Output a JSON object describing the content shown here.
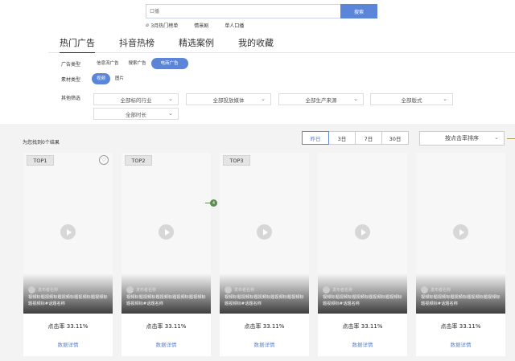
{
  "search": {
    "placeholder": "口播",
    "button": "搜索"
  },
  "hot_links": [
    "3月热门榜单",
    "情景剧",
    "单人口播"
  ],
  "tabs": [
    "热门广告",
    "抖音热榜",
    "精选案例",
    "我的收藏"
  ],
  "filters": {
    "ad_type": {
      "label": "广告类型",
      "options": [
        "信息流广告",
        "搜索广告",
        "电商广告"
      ],
      "active": 2
    },
    "material_type": {
      "label": "素材类型",
      "options": [
        "视频",
        "图片"
      ],
      "active": 0
    },
    "other": {
      "label": "其他筛选",
      "dropdowns": [
        "全部标的行业",
        "全部投放媒体",
        "全部生产来源",
        "全部版式",
        "全部时长"
      ]
    }
  },
  "results": {
    "found_text": "为您找到0个结果",
    "ranges": [
      "昨日",
      "3日",
      "7日",
      "30日"
    ],
    "active_range": 0,
    "sort": "按点击率排序"
  },
  "cards": [
    {
      "badge": "TOP1",
      "author": "发布者名称",
      "desc": "视频标题视频标题视频标题视频标题视频标题视频标#话题名称",
      "ctr": "点击率 33.11%",
      "detail": "数据详情"
    },
    {
      "badge": "TOP2",
      "author": "发布者名称",
      "desc": "视频标题视频标题视频标题视频标题视频标题视频标#话题名称",
      "ctr": "点击率 33.11%",
      "detail": "数据详情"
    },
    {
      "badge": "TOP3",
      "author": "发布者名称",
      "desc": "视频标题视频标题视频标题视频标题视频标题视频标#话题名称",
      "ctr": "点击率 33.11%",
      "detail": "数据详情"
    },
    {
      "badge": "",
      "author": "发布者名称",
      "desc": "视频标题视频标题视频标题视频标题视频标题视频标#话题名称",
      "ctr": "点击率 33.11%",
      "detail": "数据详情"
    },
    {
      "badge": "",
      "author": "发布者名称",
      "desc": "视频标题视频标题视频标题视频标题视频标题视频标#话题名称",
      "ctr": "点击率 33.11%",
      "detail": "数据详情"
    }
  ],
  "marker": "4",
  "colors": {
    "accent": "#5a85d9",
    "marker": "#5d8b4e"
  }
}
